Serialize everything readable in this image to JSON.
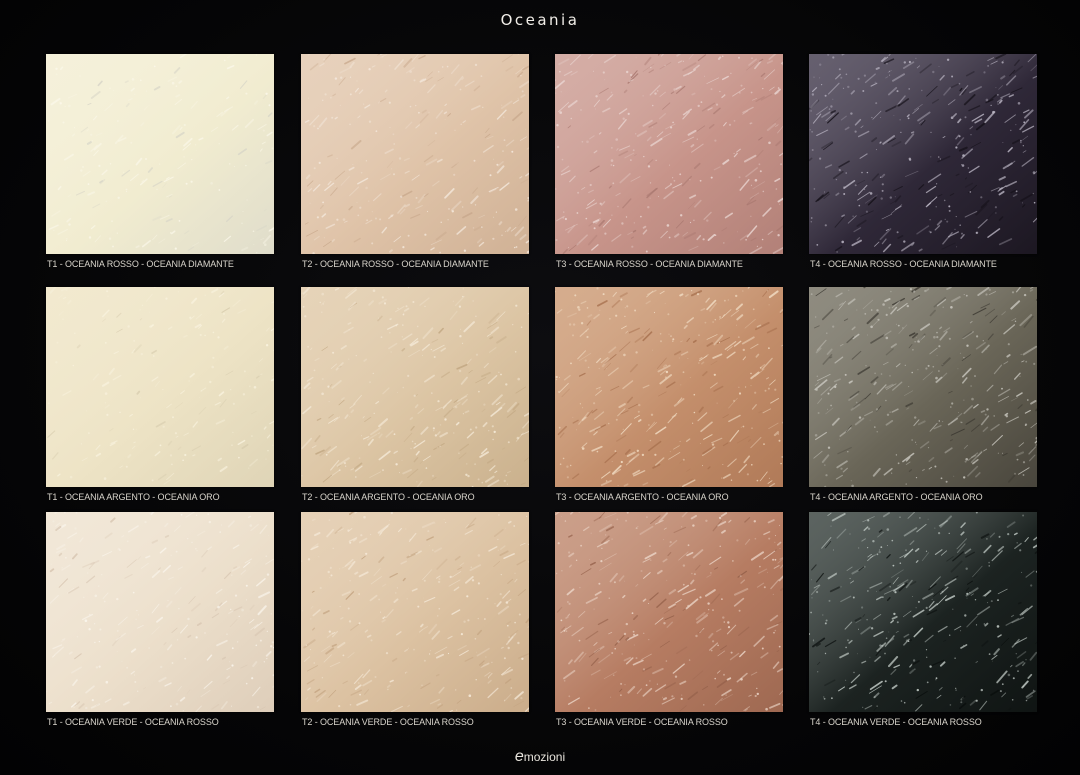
{
  "title": "Oceania",
  "brand": {
    "initial": "e",
    "rest": "mozioni"
  },
  "swatches": [
    {
      "label": "T1 - OCEANIA ROSSO - OCEANIA DIAMANTE",
      "base": "#f1ecd0",
      "light": "#fbf8ea",
      "dark": "#d8d6c8",
      "grain": 0.18
    },
    {
      "label": "T2 - OCEANIA ROSSO - OCEANIA DIAMANTE",
      "base": "#dfc3a8",
      "light": "#f4e8dc",
      "dark": "#c9a98d",
      "grain": 0.35
    },
    {
      "label": "T3 - OCEANIA ROSSO - OCEANIA DIAMANTE",
      "base": "#c7948a",
      "light": "#ead6d2",
      "dark": "#a97870",
      "grain": 0.45
    },
    {
      "label": "T4 - OCEANIA ROSSO - OCEANIA DIAMANTE",
      "base": "#2f2838",
      "light": "#bdb8c6",
      "dark": "#141018",
      "grain": 0.5
    },
    {
      "label": "T1 - OCEANIA ARGENTO - OCEANIA ORO",
      "base": "#ede3c5",
      "light": "#f9f3df",
      "dark": "#d9ceb0",
      "grain": 0.15
    },
    {
      "label": "T2 - OCEANIA ARGENTO - OCEANIA ORO",
      "base": "#dcc5a4",
      "light": "#f5ead8",
      "dark": "#c2a883",
      "grain": 0.4
    },
    {
      "label": "T3 - OCEANIA ARGENTO - OCEANIA ORO",
      "base": "#c48f6c",
      "light": "#f1dcc3",
      "dark": "#a8714f",
      "grain": 0.5
    },
    {
      "label": "T4 - OCEANIA ARGENTO - OCEANIA ORO",
      "base": "#6a6658",
      "light": "#c9c7bf",
      "dark": "#3a3730",
      "grain": 0.5
    },
    {
      "label": "T1 - OCEANIA VERDE - OCEANIA ROSSO",
      "base": "#ecdfcb",
      "light": "#faf5ec",
      "dark": "#d8c6b2",
      "grain": 0.3
    },
    {
      "label": "T2 - OCEANIA VERDE - OCEANIA ROSSO",
      "base": "#dcc2a2",
      "light": "#f5e9d8",
      "dark": "#c3a380",
      "grain": 0.4
    },
    {
      "label": "T3 - OCEANIA VERDE - OCEANIA ROSSO",
      "base": "#b67c62",
      "light": "#ecd6c8",
      "dark": "#94604a",
      "grain": 0.45
    },
    {
      "label": "T4 - OCEANIA VERDE - OCEANIA ROSSO",
      "base": "#1c2321",
      "light": "#c2cbc6",
      "dark": "#0a0e0d",
      "grain": 0.5
    }
  ]
}
